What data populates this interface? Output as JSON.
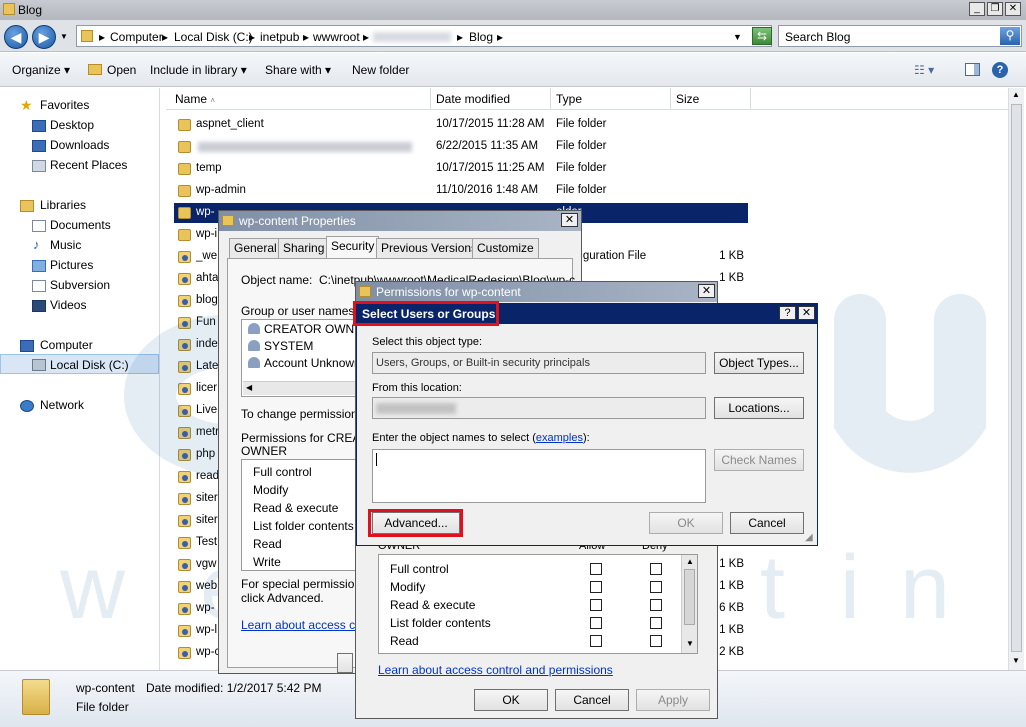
{
  "window": {
    "title": "Blog",
    "controls": [
      "_",
      "❐",
      "✕"
    ]
  },
  "address": {
    "crumbs": [
      "Computer",
      "Local Disk (C:)",
      "inetpub",
      "wwwroot",
      "Blog"
    ],
    "search_placeholder": "Search Blog"
  },
  "toolbar": {
    "organize": "Organize",
    "open": "Open",
    "include": "Include in library",
    "share": "Share with",
    "newfolder": "New folder"
  },
  "nav": {
    "favorites": "Favorites",
    "fav_items": [
      "Desktop",
      "Downloads",
      "Recent Places"
    ],
    "libraries": "Libraries",
    "lib_items": [
      "Documents",
      "Music",
      "Pictures",
      "Subversion",
      "Videos"
    ],
    "computer": "Computer",
    "comp_items": [
      "Local Disk (C:)"
    ],
    "network": "Network"
  },
  "columns": {
    "name": "Name",
    "date": "Date modified",
    "type": "Type",
    "size": "Size"
  },
  "files": [
    {
      "name": "aspnet_client",
      "date": "10/17/2015 11:28 AM",
      "type": "File folder",
      "size": ""
    },
    {
      "name": "",
      "date": "6/22/2015 11:35 AM",
      "type": "File folder",
      "size": ""
    },
    {
      "name": "temp",
      "date": "10/17/2015 11:25 AM",
      "type": "File folder",
      "size": ""
    },
    {
      "name": "wp-admin",
      "date": "11/10/2016 1:48 AM",
      "type": "File folder",
      "size": ""
    },
    {
      "name": "wp-",
      "date": "",
      "type": "older",
      "size": ""
    },
    {
      "name": "wp-i",
      "date": "",
      "type": "older",
      "size": ""
    },
    {
      "name": "_we",
      "date": "",
      "type": "Configuration File",
      "size": "1 KB"
    },
    {
      "name": "ahta",
      "date": "",
      "type": "",
      "size": "1 KB"
    },
    {
      "name": "blog",
      "date": "",
      "type": "",
      "size": ""
    },
    {
      "name": "Fun",
      "date": "",
      "type": "",
      "size": ""
    },
    {
      "name": "inde",
      "date": "",
      "type": "",
      "size": ""
    },
    {
      "name": "Late",
      "date": "",
      "type": "",
      "size": ""
    },
    {
      "name": "licer",
      "date": "",
      "type": "",
      "size": ""
    },
    {
      "name": "Live",
      "date": "",
      "type": "",
      "size": ""
    },
    {
      "name": "metr",
      "date": "",
      "type": "",
      "size": ""
    },
    {
      "name": "php",
      "date": "",
      "type": "",
      "size": ""
    },
    {
      "name": "read",
      "date": "",
      "type": "",
      "size": ""
    },
    {
      "name": "siter",
      "date": "",
      "type": "",
      "size": ""
    },
    {
      "name": "siter",
      "date": "",
      "type": "",
      "size": ""
    },
    {
      "name": "Test",
      "date": "",
      "type": "",
      "size": ""
    },
    {
      "name": "vgw",
      "date": "",
      "type": "",
      "size": "1 KB"
    },
    {
      "name": "web",
      "date": "",
      "type": "",
      "size": "1 KB"
    },
    {
      "name": "wp-",
      "date": "",
      "type": "",
      "size": "6 KB"
    },
    {
      "name": "wp-l",
      "date": "",
      "type": "",
      "size": "1 KB"
    },
    {
      "name": "wp-c",
      "date": "",
      "type": "",
      "size": "2 KB"
    }
  ],
  "status": {
    "name": "wp-content",
    "date_label": "Date modified: 1/2/2017 5:42 PM",
    "type": "File folder"
  },
  "props": {
    "title": "wp-content Properties",
    "tabs": [
      "General",
      "Sharing",
      "Security",
      "Previous Versions",
      "Customize"
    ],
    "object_label": "Object name:",
    "object_value": "C:\\inetpub\\wwwroot\\MedicalRedesign\\Blog\\wp-c",
    "group_label": "Group or user names:",
    "users": [
      "CREATOR OWNER",
      "SYSTEM",
      "Account Unknown"
    ],
    "change_text": "To change permissions,",
    "perm_label": "Permissions for CREATO",
    "perm_label2": "OWNER",
    "perms": [
      "Full control",
      "Modify",
      "Read & execute",
      "List folder contents",
      "Read",
      "Write"
    ],
    "special1": "For special permissions o",
    "special2": "click Advanced.",
    "learn": "Learn about access cor"
  },
  "perm_dialog": {
    "title": "Permissions for wp-content",
    "owner_label": "OWNER",
    "allow": "Allow",
    "deny": "Deny",
    "perms": [
      "Full control",
      "Modify",
      "Read & execute",
      "List folder contents",
      "Read"
    ],
    "learn": "Learn about access control and permissions",
    "ok": "OK",
    "cancel": "Cancel",
    "apply": "Apply"
  },
  "select_dialog": {
    "title": "Select Users or Groups",
    "help": "?",
    "type_label": "Select this object type:",
    "type_value": "Users, Groups, or Built-in security principals",
    "object_types": "Object Types...",
    "location_label": "From this location:",
    "locations": "Locations...",
    "names_label": "Enter the object names to select (",
    "names_link": "examples",
    "names_label_end": "):",
    "check_names": "Check Names",
    "advanced": "Advanced...",
    "ok": "OK",
    "cancel": "Cancel"
  },
  "watermark": {
    "brand": "acc",
    "tagline": "webhosting"
  },
  "colors": {
    "selection": "#0a246a",
    "dialog_title": "#0a246a",
    "highlight": "#e0101c",
    "watermark": "#1f5fa3"
  }
}
